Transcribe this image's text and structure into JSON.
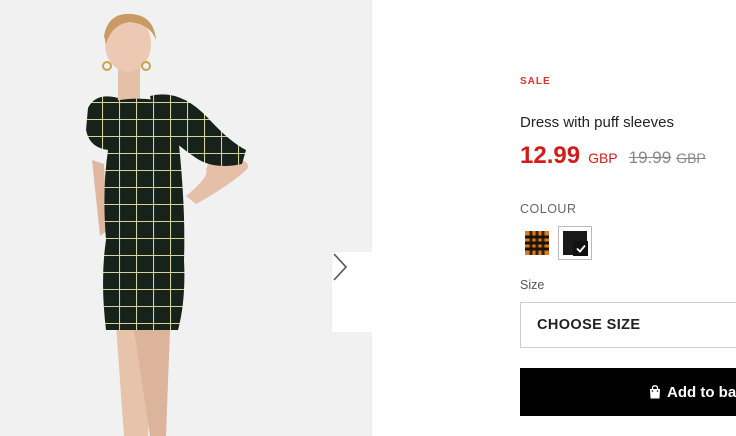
{
  "product": {
    "badge": "SALE",
    "title": "Dress with puff sleeves",
    "price_now": "12.99",
    "price_now_currency": "GBP",
    "price_old": "19.99",
    "price_old_currency": "GBP"
  },
  "colour": {
    "label": "COLOUR",
    "options": [
      {
        "name": "orange-check",
        "color": "#e07a1f",
        "selected": false
      },
      {
        "name": "black-check",
        "color": "#1a1a1a",
        "selected": true
      }
    ]
  },
  "size": {
    "label": "Size",
    "select_placeholder": "CHOOSE SIZE"
  },
  "cart": {
    "add_label": "Add to ba",
    "icon": "shopping-bag-icon"
  },
  "gallery": {
    "next_icon": "chevron-right-icon"
  },
  "colors": {
    "sale_red": "#d31b1b",
    "button_black": "#000000"
  }
}
